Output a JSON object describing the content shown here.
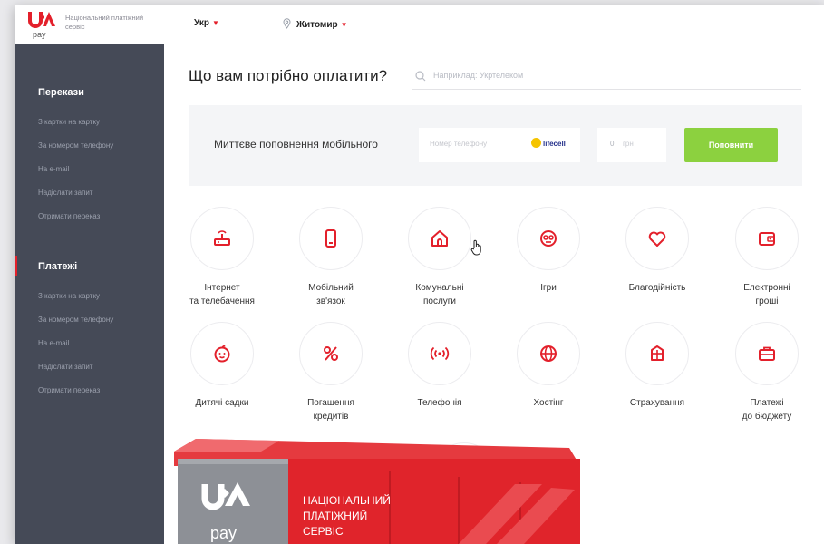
{
  "header": {
    "logo_text": "Національний платіжний сервіс",
    "logo_sub": "pay",
    "language": "Укр",
    "city": "Житомир"
  },
  "sidebar": {
    "sections": [
      {
        "title": "Перекази",
        "items": [
          "З картки на картку",
          "За номером телефону",
          "На e-mail",
          "Надіслати запит",
          "Отримати переказ"
        ]
      },
      {
        "title": "Платежі",
        "items": [
          "З картки на картку",
          "За номером телефону",
          "На e-mail",
          "Надіслати запит",
          "Отримати переказ"
        ]
      }
    ]
  },
  "main": {
    "heading": "Що вам потрібно оплатити?",
    "search_placeholder": "Наприклад: Укртелеком"
  },
  "topup": {
    "label": "Миттєве поповнення мобільного",
    "phone_placeholder": "Номер телефону",
    "operator": "lifecell",
    "amount": "0",
    "currency": "грн",
    "button": "Поповнити"
  },
  "categories": [
    {
      "label": "Інтернет\nта телебачення",
      "icon": "router-icon"
    },
    {
      "label": "Мобільний\nзв'язок",
      "icon": "mobile-phone-icon"
    },
    {
      "label": "Комунальні\nпослуги",
      "icon": "house-icon"
    },
    {
      "label": "Ігри",
      "icon": "gamepad-icon"
    },
    {
      "label": "Благодійність",
      "icon": "heart-icon"
    },
    {
      "label": "Електронні\nгроші",
      "icon": "wallet-icon"
    },
    {
      "label": "Дитячі садки",
      "icon": "baby-face-icon"
    },
    {
      "label": "Погашення\nкредитів",
      "icon": "percent-icon"
    },
    {
      "label": "Телефонія",
      "icon": "signal-icon"
    },
    {
      "label": "Хостінг",
      "icon": "globe-icon"
    },
    {
      "label": "Страхування",
      "icon": "insurance-icon"
    },
    {
      "label": "Платежі\nдо бюджету",
      "icon": "briefcase-icon"
    }
  ],
  "terminal": {
    "brand": "pay",
    "text_lines": [
      "НАЦІОНАЛЬНИЙ",
      "ПЛАТІЖНИЙ",
      "СЕРВІС"
    ]
  },
  "colors": {
    "accent": "#e3202b",
    "sidebar_bg": "#454a57",
    "button_green": "#8cd13f"
  }
}
